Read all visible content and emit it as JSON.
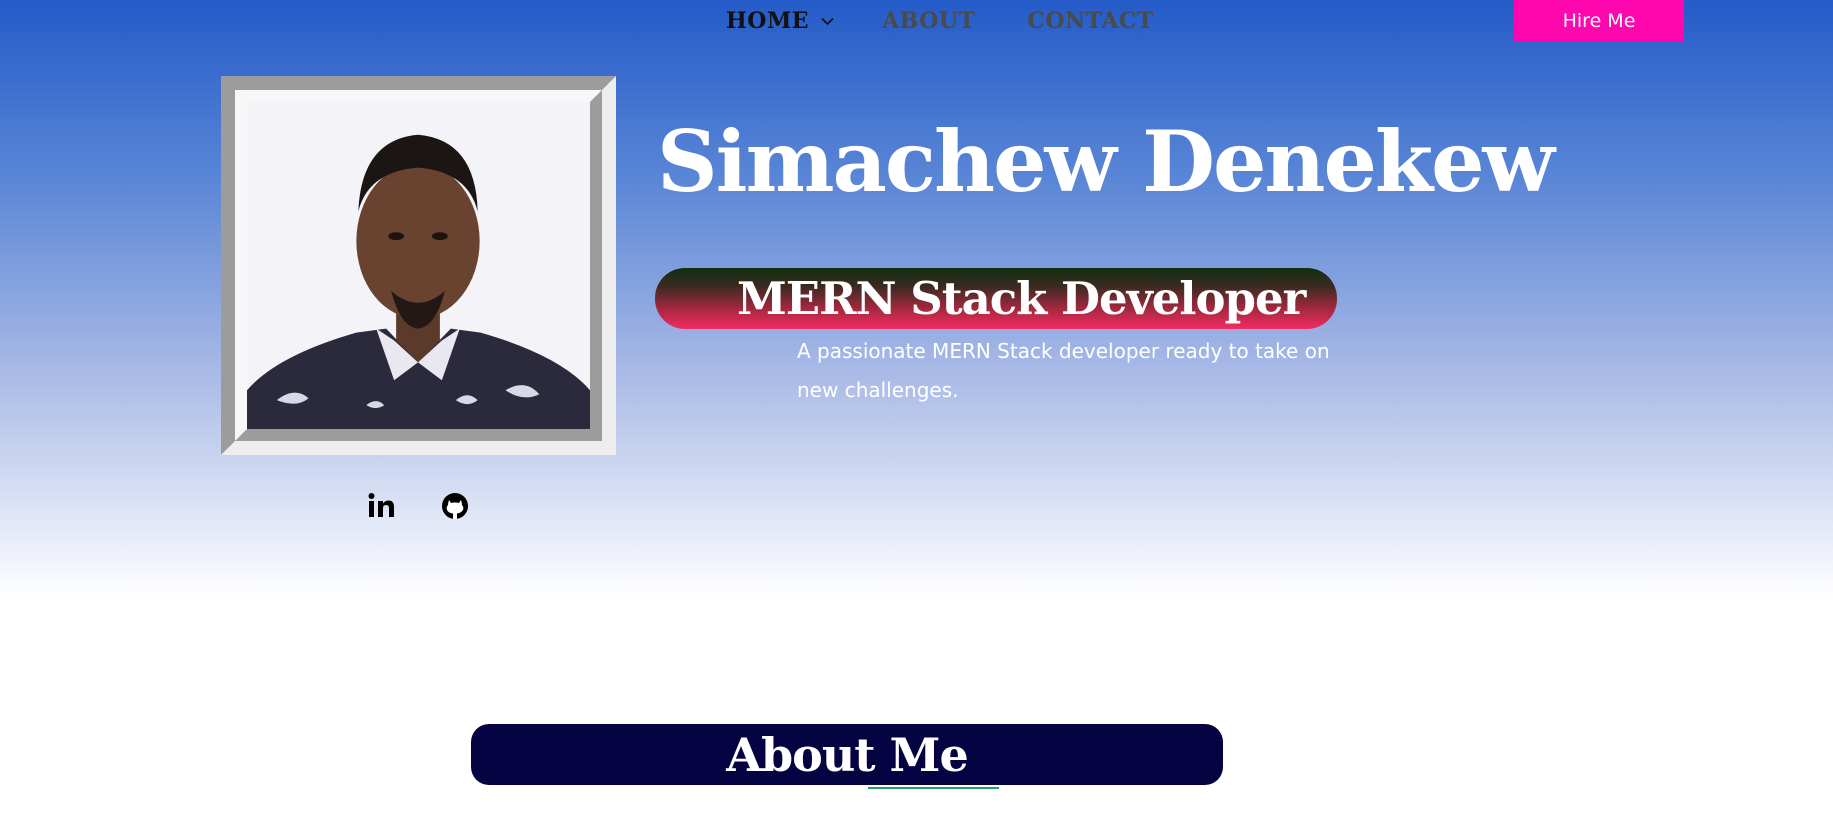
{
  "nav": {
    "home": "HOME",
    "about": "ABOUT",
    "contact": "CONTACT",
    "hire_label": "Hire Me"
  },
  "hero": {
    "name": "Simachew Denekew",
    "role": "MERN Stack Developer",
    "tagline": "A passionate MERN Stack developer ready to take on new challenges.",
    "social": [
      "linkedin-icon",
      "github-icon"
    ]
  },
  "about": {
    "title": "About Me"
  },
  "colors": {
    "accent_pink": "#ff07ae",
    "hero_top": "#245bc8",
    "about_bg": "#060342",
    "underline": "#22a06a"
  }
}
